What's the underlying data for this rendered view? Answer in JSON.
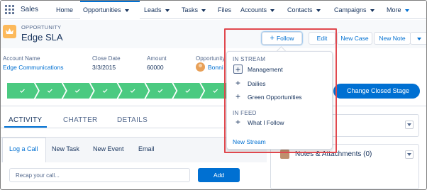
{
  "nav": {
    "app_name": "Sales",
    "tabs": [
      {
        "label": "Home",
        "dropdown": false
      },
      {
        "label": "Opportunities",
        "dropdown": true,
        "active": true
      },
      {
        "label": "Leads",
        "dropdown": true
      },
      {
        "label": "Tasks",
        "dropdown": true
      },
      {
        "label": "Files",
        "dropdown": false
      },
      {
        "label": "Accounts",
        "dropdown": true
      },
      {
        "label": "Contacts",
        "dropdown": true
      },
      {
        "label": "Campaigns",
        "dropdown": true
      },
      {
        "label": "More",
        "dropdown": true
      }
    ]
  },
  "record": {
    "type": "OPPORTUNITY",
    "title": "Edge SLA",
    "icon": "crown-icon",
    "icon_color": "#fcb95b"
  },
  "actions": {
    "follow": "Follow",
    "edit": "Edit",
    "new_case": "New Case",
    "new_note": "New Note"
  },
  "fields": [
    {
      "label": "Account Name",
      "value": "Edge Communications",
      "link": true
    },
    {
      "label": "Close Date",
      "value": "3/3/2015",
      "link": false
    },
    {
      "label": "Amount",
      "value": "60000",
      "link": false
    },
    {
      "label": "Opportunity",
      "value": "Bonni",
      "link": true
    }
  ],
  "path": {
    "completed_stages": 9,
    "stage_color": "#4bca81",
    "button_label": "Change Closed Stage"
  },
  "tabs": {
    "activity": "ACTIVITY",
    "chatter": "CHATTER",
    "details": "DETAILS"
  },
  "subtabs": {
    "log_call": "Log a Call",
    "new_task": "New Task",
    "new_event": "New Event",
    "email": "Email"
  },
  "composer": {
    "placeholder": "Recap your call...",
    "add_label": "Add"
  },
  "right_panel": {
    "notes_title": "Notes & Attachments (0)"
  },
  "follow_menu": {
    "in_stream": "IN STREAM",
    "stream_items": [
      "Management",
      "Dailies",
      "Green Opportunities"
    ],
    "in_feed": "IN FEED",
    "feed_items": [
      "What I Follow"
    ],
    "new_stream": "New Stream"
  },
  "colors": {
    "brand": "#0070d2",
    "highlight": "#e0484e"
  }
}
